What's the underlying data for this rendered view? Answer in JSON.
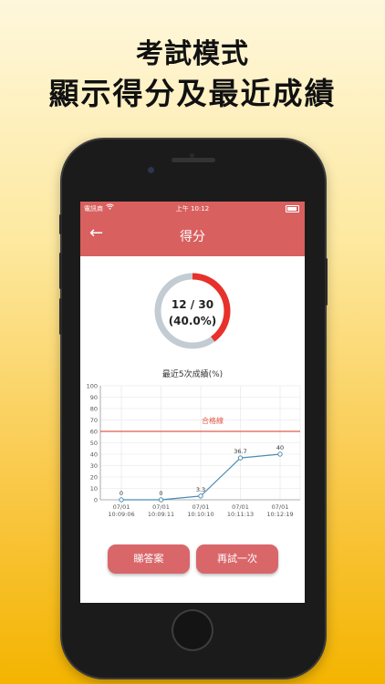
{
  "promo": {
    "line1": "考試模式",
    "line2": "顯示得分及最近成績"
  },
  "status_bar": {
    "carrier": "電訊商",
    "wifi": "wifi-icon",
    "time": "上午 10:12",
    "battery": "battery-icon"
  },
  "nav": {
    "back_icon": "arrow-left-icon",
    "title": "得分"
  },
  "score": {
    "correct": 12,
    "total": 30,
    "fraction_text": "12 / 30",
    "percent_text": "(40.0%)",
    "progress": 0.4,
    "ring_color": "#e8312a",
    "track_color": "#c3ccd2"
  },
  "chart_title": "最近5次成績(%)",
  "chart_data": {
    "type": "line",
    "categories": [
      "07/01\n10:09:06",
      "07/01\n10:09:11",
      "07/01\n10:10:10",
      "07/01\n10:11:13",
      "07/01\n10:12:19"
    ],
    "x_labels_date": [
      "07/01",
      "07/01",
      "07/01",
      "07/01",
      "07/01"
    ],
    "x_labels_time": [
      "10:09:06",
      "10:09:11",
      "10:10:10",
      "10:11:13",
      "10:12:19"
    ],
    "values": [
      0,
      0,
      3.3,
      36.7,
      40
    ],
    "value_labels": [
      "0",
      "0",
      "3.3",
      "36.7",
      "40"
    ],
    "ylim": [
      0,
      100
    ],
    "yticks": [
      "0",
      "10",
      "20",
      "30",
      "40",
      "50",
      "60",
      "70",
      "80",
      "90",
      "100"
    ],
    "pass_line": {
      "value": 60,
      "label": "合格線",
      "color": "#e05a48"
    },
    "line_color": "#4c8db5",
    "grid": true
  },
  "buttons": {
    "answers": "睇答案",
    "retry": "再試一次"
  },
  "colors": {
    "accent": "#d8605f",
    "button": "#d9676a"
  }
}
